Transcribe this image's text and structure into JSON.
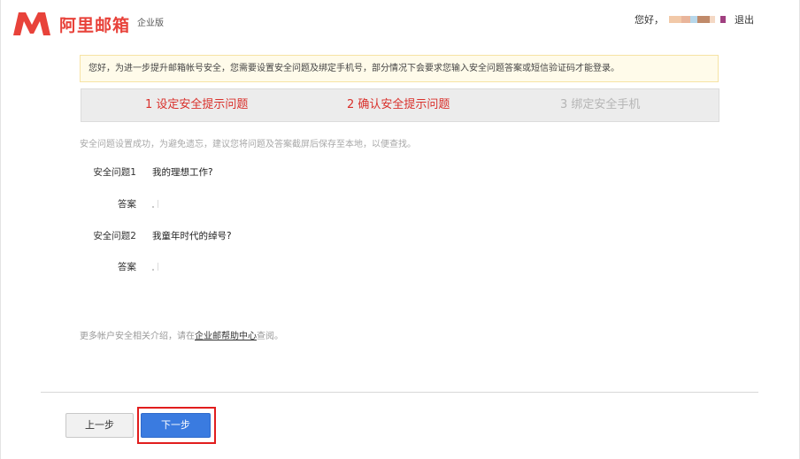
{
  "header": {
    "brand": "阿里邮箱",
    "edition": "企业版",
    "greeting": "您好，",
    "logout": "退出"
  },
  "notice": {
    "text": "您好，为进一步提升邮箱帐号安全，您需要设置安全问题及绑定手机号，部分情况下会要求您输入安全问题答案或短信验证码才能登录。"
  },
  "steps": [
    {
      "label": "1 设定安全提示问题",
      "state": "done"
    },
    {
      "label": "2 确认安全提示问题",
      "state": "active"
    },
    {
      "label": "3 绑定安全手机",
      "state": "pending"
    }
  ],
  "hint": "安全问题设置成功，为避免遗忘，建议您将问题及答案截屏后保存至本地，以便查找。",
  "questions": [
    {
      "label": "安全问题1",
      "question": "我的理想工作?",
      "answer_label": "答案"
    },
    {
      "label": "安全问题2",
      "question": "我童年时代的绰号?",
      "answer_label": "答案"
    }
  ],
  "more": {
    "prefix": "更多帐户安全相关介绍，请在",
    "link": "企业邮帮助中心",
    "suffix": "查阅。"
  },
  "buttons": {
    "prev": "上一步",
    "next": "下一步"
  },
  "colors": {
    "brand_red": "#e8423a",
    "step_active": "#d9302b",
    "primary_blue": "#3a7be0",
    "highlight_border": "#e11d1d"
  }
}
